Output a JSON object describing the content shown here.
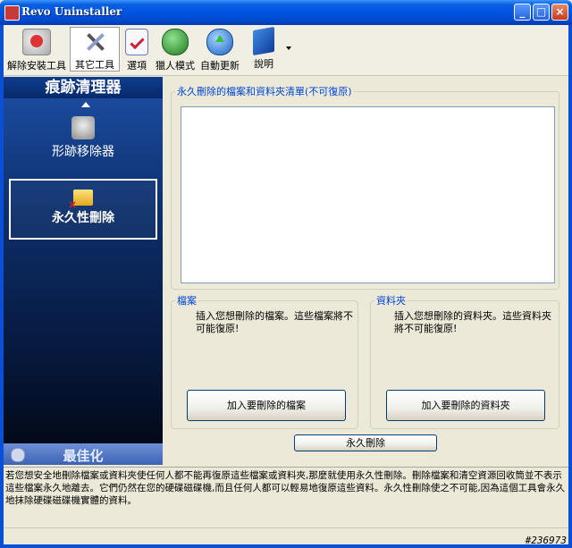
{
  "window": {
    "title": "Revo Uninstaller"
  },
  "toolbar": {
    "items": [
      {
        "label": "解除安裝工具",
        "icon": "uninstaller-icon"
      },
      {
        "label": "其它工具",
        "icon": "tools-icon"
      },
      {
        "label": "選項",
        "icon": "options-icon"
      },
      {
        "label": "獵人模式",
        "icon": "hunter-mode-icon"
      },
      {
        "label": "自動更新",
        "icon": "auto-update-icon"
      },
      {
        "label": "說明",
        "icon": "help-icon"
      }
    ]
  },
  "sidebar": {
    "header": "痕跡清理器",
    "items": [
      {
        "label": "形跡移除器",
        "icon": "evidence-remover-icon"
      },
      {
        "label": "永久性刪除",
        "icon": "unrecoverable-delete-icon"
      }
    ],
    "bottom_label": "最佳化"
  },
  "main": {
    "list_group_title": "永久刪除的檔案和資料夾清單(不可復原)",
    "files_group": {
      "title": "檔案",
      "description": "插入您想刪除的檔案。這些檔案將不可能復原!",
      "button": "加入要刪除的檔案"
    },
    "folders_group": {
      "title": "資料夾",
      "description": "插入您想刪除的資料夾。這些資料夾將不可能復原!",
      "button": "加入要刪除的資料夾"
    },
    "delete_button": "永久刪除"
  },
  "status": {
    "text": "若您想安全地刪除檔案或資料夾使任何人都不能再復原這些檔案或資料夾,那麼就使用永久性刪除。刪除檔案和清空資源回收筒並不表示這些檔案永久地離去。它們仍然在您的硬碟磁碟機,而且任何人都可以輕易地復原這些資料。永久性刪除使之不可能,因為這個工具會永久地抹除硬碟磁碟機實體的資料。"
  },
  "watermark": "#236973",
  "colors": {
    "accent": "#0046d5",
    "sidebar_top": "#1d4fa6",
    "sidebar_bottom": "#02060f",
    "titlebar": "#0054e3"
  }
}
